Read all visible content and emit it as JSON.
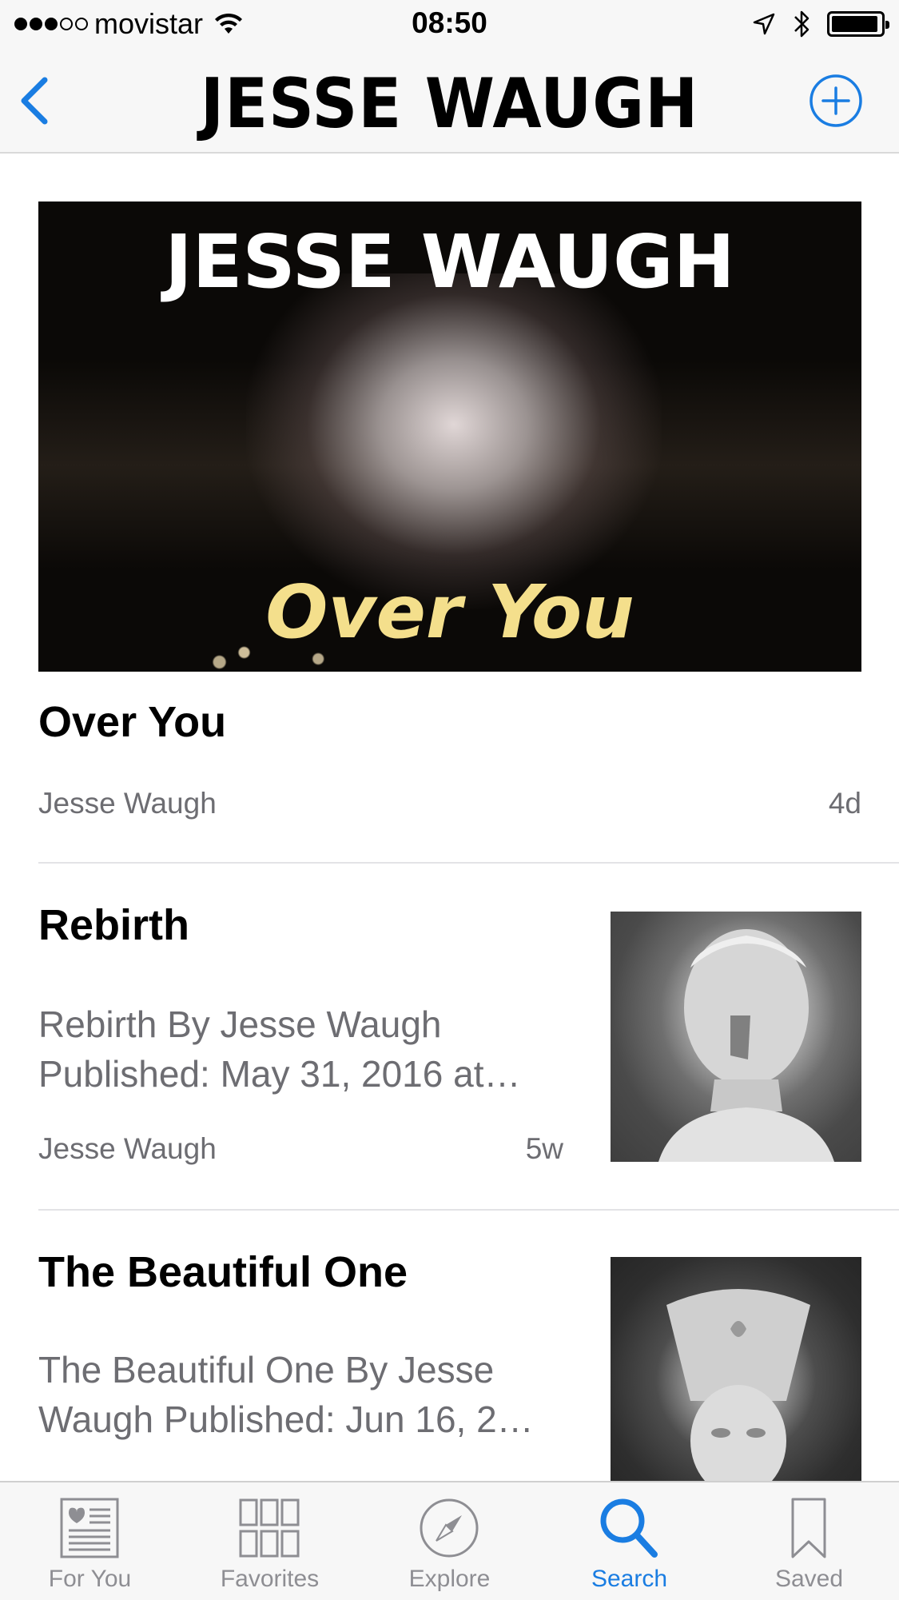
{
  "status_bar": {
    "carrier": "movistar",
    "time": "08:50",
    "signal_bars": 3,
    "battery_level": 0.95
  },
  "nav": {
    "title": "JESSE WAUGH",
    "back_icon": "chevron-left-icon",
    "add_icon": "plus-circle-icon"
  },
  "hero": {
    "artist_text": "JESSE WAUGH",
    "song_text": "Over You"
  },
  "articles": [
    {
      "title": "Over You",
      "source": "Jesse Waugh",
      "age": "4d"
    },
    {
      "title": "Rebirth",
      "description": "Rebirth By Jesse Waugh Published: May 31, 2016 at…",
      "source": "Jesse Waugh",
      "age": "5w"
    },
    {
      "title": "The Beautiful One",
      "description": "The Beautiful One By Jesse Waugh Published: Jun 16, 2…"
    }
  ],
  "tabs": [
    {
      "label": "For You",
      "icon": "newspaper-heart-icon"
    },
    {
      "label": "Favorites",
      "icon": "grid-icon"
    },
    {
      "label": "Explore",
      "icon": "compass-icon"
    },
    {
      "label": "Search",
      "icon": "search-icon",
      "active": true
    },
    {
      "label": "Saved",
      "icon": "bookmark-icon"
    }
  ],
  "colors": {
    "accent": "#1a7de2",
    "secondary_text": "#6d6d72",
    "inactive_tab": "#8e8e93",
    "hero_song": "#f4df8c"
  }
}
